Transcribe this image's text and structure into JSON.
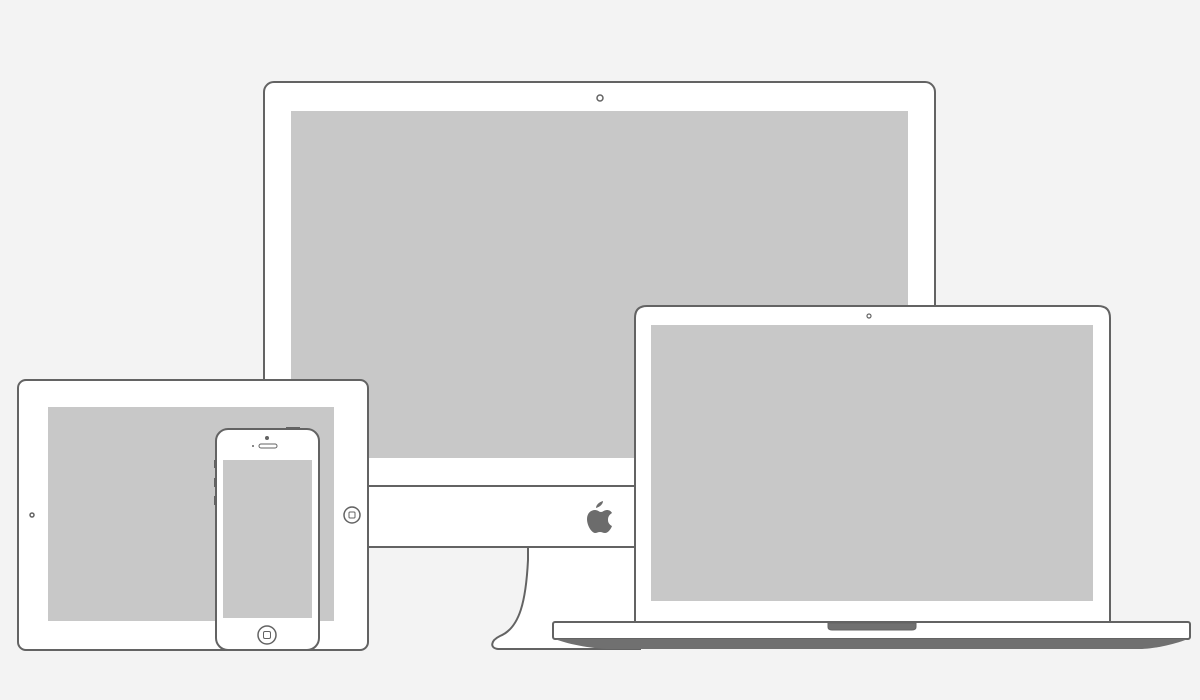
{
  "colors": {
    "background": "#f3f3f3",
    "outline": "#636363",
    "body": "#ffffff",
    "screen": "#c8c8c8",
    "dark": "#707070"
  },
  "icons": {
    "brand_logo": "apple-logo-icon",
    "camera": "camera-icon",
    "home_button": "home-button-icon"
  },
  "devices": [
    "desktop-monitor",
    "laptop",
    "tablet",
    "smartphone"
  ]
}
